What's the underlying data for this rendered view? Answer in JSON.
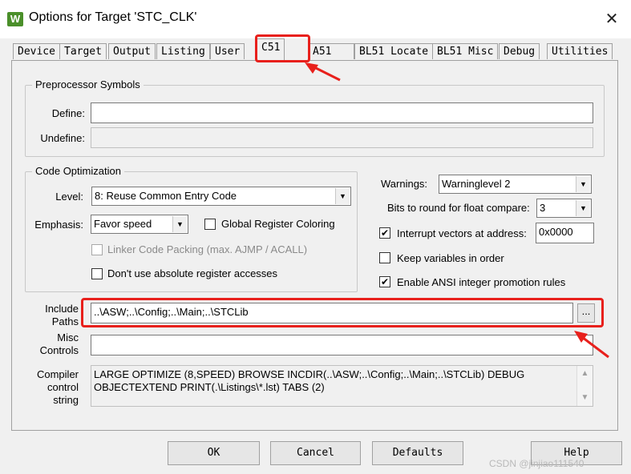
{
  "window": {
    "title": "Options for Target 'STC_CLK'",
    "icon_glyph": "W",
    "close_glyph": "✕"
  },
  "tabs": [
    {
      "label": "Device"
    },
    {
      "label": "Target"
    },
    {
      "label": "Output"
    },
    {
      "label": "Listing"
    },
    {
      "label": "User"
    },
    {
      "label": "C51",
      "active": true
    },
    {
      "label": "A51"
    },
    {
      "label": "BL51 Locate"
    },
    {
      "label": "BL51 Misc"
    },
    {
      "label": "Debug"
    },
    {
      "label": "Utilities"
    }
  ],
  "preprocessor": {
    "title": "Preprocessor Symbols",
    "define_label": "Define:",
    "define_value": "",
    "undefine_label": "Undefine:",
    "undefine_value": ""
  },
  "code_optimization": {
    "title": "Code Optimization",
    "level_label": "Level:",
    "level_value": "8: Reuse Common Entry Code",
    "emphasis_label": "Emphasis:",
    "emphasis_value": "Favor speed",
    "global_register_coloring": {
      "label": "Global Register Coloring",
      "checked": false
    },
    "linker_code_packing": {
      "label": "Linker Code Packing (max. AJMP / ACALL)",
      "checked": false,
      "disabled": true
    },
    "dont_use_absolute": {
      "label": "Don't use absolute register accesses",
      "checked": false
    }
  },
  "warnings": {
    "label": "Warnings:",
    "value": "Warninglevel 2",
    "bits_label": "Bits to round for float compare:",
    "bits_value": "3",
    "interrupt_vectors": {
      "label": "Interrupt vectors at address:",
      "checked": true,
      "address": "0x0000"
    },
    "keep_variables": {
      "label": "Keep variables in order",
      "checked": false
    },
    "ansi_promotion": {
      "label": "Enable ANSI integer promotion rules",
      "checked": true
    },
    "check_glyph": "✔"
  },
  "include_paths": {
    "label_line1": "Include",
    "label_line2": "Paths",
    "value": "..\\ASW;..\\Config;..\\Main;..\\STCLib",
    "browse_label": "..."
  },
  "misc_controls": {
    "label_line1": "Misc",
    "label_line2": "Controls",
    "value": ""
  },
  "compiler_control": {
    "label_line1": "Compiler",
    "label_line2": "control",
    "label_line3": "string",
    "value": "LARGE OPTIMIZE (8,SPEED) BROWSE INCDIR(..\\ASW;..\\Config;..\\Main;..\\STCLib) DEBUG OBJECTEXTEND PRINT(.\\Listings\\*.lst) TABS (2)",
    "scroll_up": "▲",
    "scroll_down": "▼"
  },
  "buttons": {
    "ok": "OK",
    "cancel": "Cancel",
    "defaults": "Defaults",
    "help": "Help"
  },
  "combo_arrow": "▼",
  "watermark": "CSDN @jinjiao111540",
  "colors": {
    "highlight": "#e8201c",
    "dialog_bg": "#f0f0f0"
  }
}
